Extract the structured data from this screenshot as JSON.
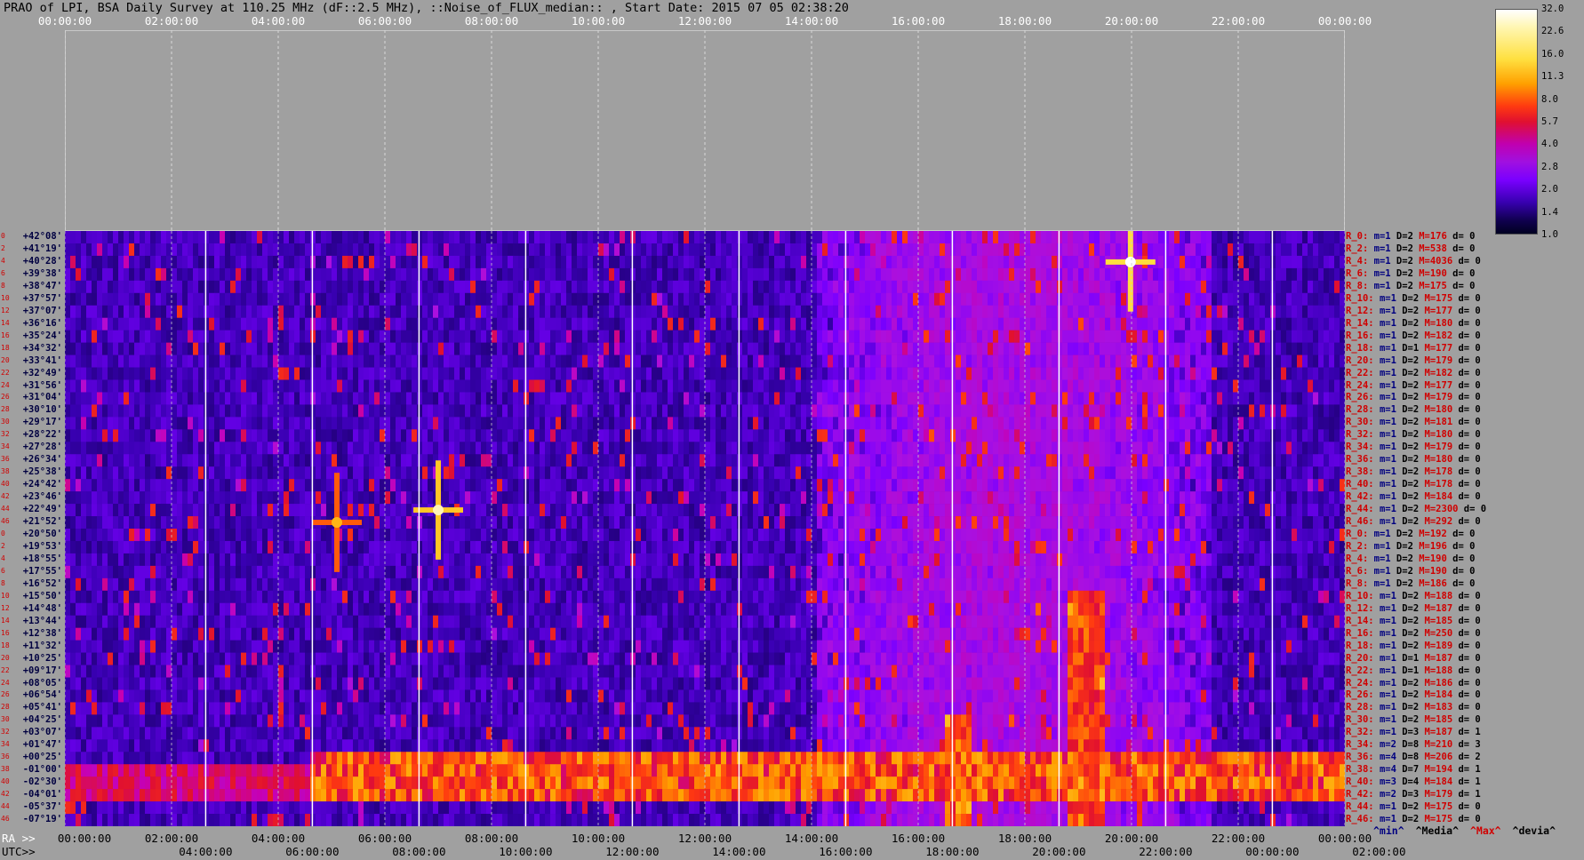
{
  "title": "PRAO of LPI, BSA Daily Survey at 110.25 MHz (dF::2.5 MHz), ::Noise_of_FLUX_median:: , Start Date: 2015 07 05 02:38:20",
  "chart_data": {
    "type": "heatmap",
    "title": "PRAO of LPI, BSA Daily Survey at 110.25 MHz (dF::2.5 MHz), ::Noise_of_FLUX_median:: , Start Date: 2015 07 05 02:38:20",
    "top_axis_ticks": [
      "00:00:00",
      "02:00:00",
      "04:00:00",
      "06:00:00",
      "08:00:00",
      "10:00:00",
      "12:00:00",
      "14:00:00",
      "16:00:00",
      "18:00:00",
      "20:00:00",
      "22:00:00",
      "00:00:00"
    ],
    "ra_axis_prefix": "RA >>",
    "ra_axis_ticks": [
      "00:00:00",
      "02:00:00",
      "04:00:00",
      "06:00:00",
      "08:00:00",
      "10:00:00",
      "12:00:00",
      "14:00:00",
      "16:00:00",
      "18:00:00",
      "20:00:00",
      "22:00:00",
      "00:00:00"
    ],
    "utc_axis_prefix": "UTC>>",
    "utc_axis_ticks": [
      "04:00:00",
      "06:00:00",
      "08:00:00",
      "10:00:00",
      "12:00:00",
      "14:00:00",
      "16:00:00",
      "18:00:00",
      "20:00:00",
      "22:00:00",
      "00:00:00",
      "02:00:00"
    ],
    "declination_labels": [
      "+42°08'",
      "+41°19'",
      "+40°28'",
      "+39°38'",
      "+38°47'",
      "+37°57'",
      "+37°07'",
      "+36°16'",
      "+35°24'",
      "+34°32'",
      "+33°41'",
      "+32°49'",
      "+31°56'",
      "+31°04'",
      "+30°10'",
      "+29°17'",
      "+28°22'",
      "+27°28'",
      "+26°34'",
      "+25°38'",
      "+24°42'",
      "+23°46'",
      "+22°49'",
      "+21°52'",
      "+20°50'",
      "+19°53'",
      "+18°55'",
      "+17°55'",
      "+16°52'",
      "+15°50'",
      "+14°48'",
      "+13°44'",
      "+12°38'",
      "+11°32'",
      "+10°25'",
      "+09°17'",
      "+08°05'",
      "+06°54'",
      "+05°41'",
      "+04°25'",
      "+03°07'",
      "+01°47'",
      "+00°25'",
      "-01°00'",
      "-02°30'",
      "-04°01'",
      "-05°37'",
      "-07°19'"
    ],
    "row_indices": [
      "0",
      "2",
      "4",
      "6",
      "8",
      "10",
      "12",
      "14",
      "16",
      "18",
      "20",
      "22",
      "24",
      "26",
      "28",
      "30",
      "32",
      "34",
      "36",
      "38",
      "40",
      "42",
      "44",
      "46",
      "0",
      "2",
      "4",
      "6",
      "8",
      "10",
      "12",
      "14",
      "16",
      "18",
      "20",
      "22",
      "24",
      "26",
      "28",
      "30",
      "32",
      "34",
      "36",
      "38",
      "40",
      "42",
      "44",
      "46"
    ],
    "row_stats": [
      {
        "r": "R_0:",
        "m": "m=1",
        "d": "D=2",
        "M": "M=176",
        "dv": "d= 0"
      },
      {
        "r": "R_2:",
        "m": "m=1",
        "d": "D=2",
        "M": "M=538",
        "dv": "d= 0"
      },
      {
        "r": "R_4:",
        "m": "m=1",
        "d": "D=2",
        "M": "M=4036",
        "dv": "d= 0"
      },
      {
        "r": "R_6:",
        "m": "m=1",
        "d": "D=2",
        "M": "M=190",
        "dv": "d= 0"
      },
      {
        "r": "R_8:",
        "m": "m=1",
        "d": "D=2",
        "M": "M=175",
        "dv": "d= 0"
      },
      {
        "r": "R_10:",
        "m": "m=1",
        "d": "D=2",
        "M": "M=175",
        "dv": "d= 0"
      },
      {
        "r": "R_12:",
        "m": "m=1",
        "d": "D=2",
        "M": "M=177",
        "dv": "d= 0"
      },
      {
        "r": "R_14:",
        "m": "m=1",
        "d": "D=2",
        "M": "M=180",
        "dv": "d= 0"
      },
      {
        "r": "R_16:",
        "m": "m=1",
        "d": "D=2",
        "M": "M=182",
        "dv": "d= 0"
      },
      {
        "r": "R_18:",
        "m": "m=1",
        "d": "D=1",
        "M": "M=177",
        "dv": "d= 0"
      },
      {
        "r": "R_20:",
        "m": "m=1",
        "d": "D=2",
        "M": "M=179",
        "dv": "d= 0"
      },
      {
        "r": "R_22:",
        "m": "m=1",
        "d": "D=2",
        "M": "M=182",
        "dv": "d= 0"
      },
      {
        "r": "R_24:",
        "m": "m=1",
        "d": "D=2",
        "M": "M=177",
        "dv": "d= 0"
      },
      {
        "r": "R_26:",
        "m": "m=1",
        "d": "D=2",
        "M": "M=179",
        "dv": "d= 0"
      },
      {
        "r": "R_28:",
        "m": "m=1",
        "d": "D=2",
        "M": "M=180",
        "dv": "d= 0"
      },
      {
        "r": "R_30:",
        "m": "m=1",
        "d": "D=2",
        "M": "M=181",
        "dv": "d= 0"
      },
      {
        "r": "R_32:",
        "m": "m=1",
        "d": "D=2",
        "M": "M=180",
        "dv": "d= 0"
      },
      {
        "r": "R_34:",
        "m": "m=1",
        "d": "D=2",
        "M": "M=179",
        "dv": "d= 0"
      },
      {
        "r": "R_36:",
        "m": "m=1",
        "d": "D=2",
        "M": "M=180",
        "dv": "d= 0"
      },
      {
        "r": "R_38:",
        "m": "m=1",
        "d": "D=2",
        "M": "M=178",
        "dv": "d= 0"
      },
      {
        "r": "R_40:",
        "m": "m=1",
        "d": "D=2",
        "M": "M=178",
        "dv": "d= 0"
      },
      {
        "r": "R_42:",
        "m": "m=1",
        "d": "D=2",
        "M": "M=184",
        "dv": "d= 0"
      },
      {
        "r": "R_44:",
        "m": "m=1",
        "d": "D=2",
        "M": "M=2300",
        "dv": "d= 0"
      },
      {
        "r": "R_46:",
        "m": "m=1",
        "d": "D=2",
        "M": "M=292",
        "dv": "d= 0"
      },
      {
        "r": "R_0:",
        "m": "m=1",
        "d": "D=2",
        "M": "M=192",
        "dv": "d= 0"
      },
      {
        "r": "R_2:",
        "m": "m=1",
        "d": "D=2",
        "M": "M=196",
        "dv": "d= 0"
      },
      {
        "r": "R_4:",
        "m": "m=1",
        "d": "D=2",
        "M": "M=190",
        "dv": "d= 0"
      },
      {
        "r": "R_6:",
        "m": "m=1",
        "d": "D=2",
        "M": "M=190",
        "dv": "d= 0"
      },
      {
        "r": "R_8:",
        "m": "m=1",
        "d": "D=2",
        "M": "M=186",
        "dv": "d= 0"
      },
      {
        "r": "R_10:",
        "m": "m=1",
        "d": "D=2",
        "M": "M=188",
        "dv": "d= 0"
      },
      {
        "r": "R_12:",
        "m": "m=1",
        "d": "D=2",
        "M": "M=187",
        "dv": "d= 0"
      },
      {
        "r": "R_14:",
        "m": "m=1",
        "d": "D=2",
        "M": "M=185",
        "dv": "d= 0"
      },
      {
        "r": "R_16:",
        "m": "m=1",
        "d": "D=2",
        "M": "M=250",
        "dv": "d= 0"
      },
      {
        "r": "R_18:",
        "m": "m=1",
        "d": "D=2",
        "M": "M=189",
        "dv": "d= 0"
      },
      {
        "r": "R_20:",
        "m": "m=1",
        "d": "D=1",
        "M": "M=187",
        "dv": "d= 0"
      },
      {
        "r": "R_22:",
        "m": "m=1",
        "d": "D=1",
        "M": "M=188",
        "dv": "d= 0"
      },
      {
        "r": "R_24:",
        "m": "m=1",
        "d": "D=2",
        "M": "M=186",
        "dv": "d= 0"
      },
      {
        "r": "R_26:",
        "m": "m=1",
        "d": "D=2",
        "M": "M=184",
        "dv": "d= 0"
      },
      {
        "r": "R_28:",
        "m": "m=1",
        "d": "D=2",
        "M": "M=183",
        "dv": "d= 0"
      },
      {
        "r": "R_30:",
        "m": "m=1",
        "d": "D=2",
        "M": "M=185",
        "dv": "d= 0"
      },
      {
        "r": "R_32:",
        "m": "m=1",
        "d": "D=3",
        "M": "M=187",
        "dv": "d= 1"
      },
      {
        "r": "R_34:",
        "m": "m=2",
        "d": "D=8",
        "M": "M=210",
        "dv": "d= 3"
      },
      {
        "r": "R_36:",
        "m": "m=4",
        "d": "D=8",
        "M": "M=206",
        "dv": "d= 2"
      },
      {
        "r": "R_38:",
        "m": "m=4",
        "d": "D=7",
        "M": "M=194",
        "dv": "d= 1"
      },
      {
        "r": "R_40:",
        "m": "m=3",
        "d": "D=4",
        "M": "M=184",
        "dv": "d= 1"
      },
      {
        "r": "R_42:",
        "m": "m=2",
        "d": "D=3",
        "M": "M=179",
        "dv": "d= 1"
      },
      {
        "r": "R_44:",
        "m": "m=1",
        "d": "D=2",
        "M": "M=175",
        "dv": "d= 0"
      },
      {
        "r": "R_46:",
        "m": "m=1",
        "d": "D=2",
        "M": "M=175",
        "dv": "d= 0"
      }
    ],
    "colorbar_ticks": [
      "32.0",
      "22.6",
      "16.0",
      "11.3",
      "8.0",
      "5.7",
      "4.0",
      "2.8",
      "2.0",
      "1.4",
      "1.0"
    ],
    "colorbar_range": [
      1.0,
      32.0
    ],
    "colorbar_scale": "log",
    "legend": {
      "min": "^min^",
      "median": "^Media^",
      "max": "^Max^",
      "devia": "^devia^"
    },
    "colors": {
      "background": "#a0a0a0",
      "min": "#000080",
      "median": "#000000",
      "max": "#d00000",
      "devia": "#000000"
    },
    "grid": true,
    "features": [
      {
        "name": "bright source",
        "ra_hours": 19.98,
        "dec_row": 2,
        "peak": 32.0
      },
      {
        "name": "bright source",
        "ra_hours": 7.0,
        "dec_row": 22,
        "peak": 28.0
      },
      {
        "name": "bright source",
        "ra_hours": 5.1,
        "dec_row": 23,
        "peak": 18.0
      },
      {
        "name": "galactic plane band",
        "dec_rows": [
          42,
          45
        ],
        "ra_from_hours": 0.0,
        "ra_to_hours": 24.0,
        "level": 12.0
      }
    ]
  }
}
